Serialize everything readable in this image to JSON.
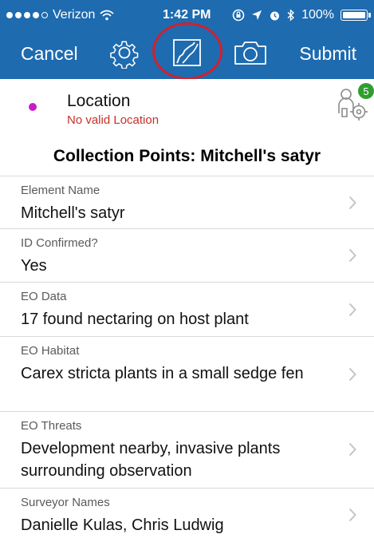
{
  "status_bar": {
    "carrier": "Verizon",
    "time": "1:42 PM",
    "battery": "100%"
  },
  "toolbar": {
    "cancel_label": "Cancel",
    "submit_label": "Submit"
  },
  "location": {
    "title": "Location",
    "subtitle": "No valid Location",
    "badge_count": "5"
  },
  "section_title": "Collection Points: Mitchell's satyr",
  "fields": [
    {
      "label": "Element Name",
      "value": "Mitchell's satyr"
    },
    {
      "label": "ID Confirmed?",
      "value": "Yes"
    },
    {
      "label": "EO Data",
      "value": "17 found nectaring on host plant"
    },
    {
      "label": "EO Habitat",
      "value": "Carex stricta plants in a small sedge fen"
    },
    {
      "label": "EO Threats",
      "value": "Development nearby, invasive plants surrounding observation"
    },
    {
      "label": "Surveyor Names",
      "value": "Danielle Kulas, Chris Ludwig"
    }
  ],
  "colors": {
    "toolbar": "#1e6bb0",
    "annotation_ring": "#d2202c",
    "error_text": "#c6302a",
    "location_dot": "#c71ec7",
    "badge": "#2f9e2e"
  }
}
